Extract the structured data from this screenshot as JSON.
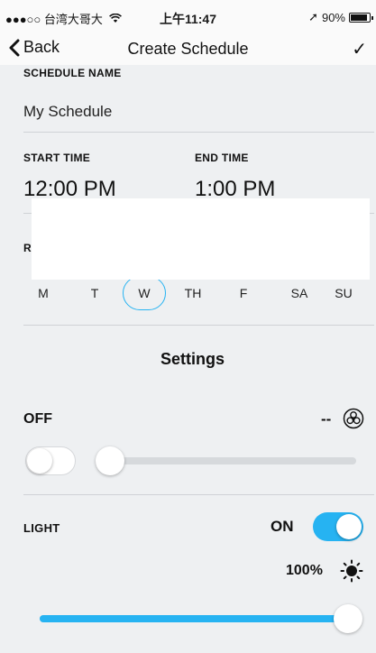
{
  "status_bar": {
    "carrier": "●●●○○ 台湾大哥大",
    "time": "上午11:47",
    "location_glyph": "➚",
    "battery": "90%"
  },
  "nav": {
    "back_label": "Back",
    "title": "Create Schedule",
    "confirm_glyph": "✓"
  },
  "schedule_name": {
    "label": "SCHEDULE NAME",
    "value": "My Schedule"
  },
  "times": {
    "start_label": "START TIME",
    "start_value": "12:00 PM",
    "end_label": "END TIME",
    "end_value": "1:00 PM"
  },
  "repeat": {
    "label_initial": "R",
    "days": [
      "M",
      "T",
      "W",
      "TH",
      "F",
      "SA",
      "SU"
    ],
    "selected": "W"
  },
  "settings": {
    "heading": "Settings",
    "fan": {
      "state": "OFF",
      "speed": "--",
      "toggle_on": false,
      "slider_level": 0
    },
    "light": {
      "label": "LIGHT",
      "state": "ON",
      "toggle_on": true,
      "brightness": "100%",
      "slider_level": 1.0
    }
  },
  "colors": {
    "accent": "#26b3f2",
    "track": "#d6d9dc",
    "background": "#eef0f2"
  }
}
